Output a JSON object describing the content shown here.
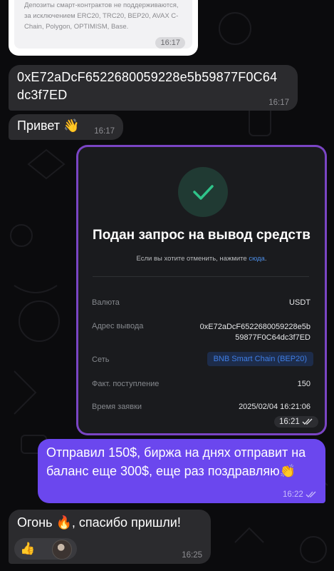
{
  "colors": {
    "chat_bg": "#0b0b0d",
    "incoming_bubble": "#2b2b2e",
    "outgoing_bubble": "#6b47ee",
    "image_border": "#7a45c4",
    "success_green": "#2fc48a",
    "link_blue": "#4c8ee8"
  },
  "messages": {
    "quoted_card": {
      "text": "Депозиты смарт-контрактов не поддерживаются, за исключением ERC20, TRC20, BEP20, AVAX C-Chain, Polygon, OPTIMISM, Base.",
      "time": "16:17"
    },
    "address": {
      "text": "0xE72aDcF6522680059228e5b59877F0C64dc3f7ED",
      "time": "16:17"
    },
    "greeting": {
      "text": "Привет 👋",
      "time": "16:17"
    },
    "withdraw_screenshot": {
      "icon": "check-icon",
      "title": "Подан запрос на вывод средств",
      "subtitle_prefix": "Если вы хотите отменить, нажмите ",
      "subtitle_link": "сюда",
      "subtitle_suffix": ".",
      "rows": [
        {
          "label": "Валюта",
          "value": "USDT"
        },
        {
          "label": "Адрес вывода",
          "value_line1": "0xE72aDcF6522680059228e5b",
          "value_line2": "59877F0C64dc3f7ED"
        },
        {
          "label": "Сеть",
          "value": "BNB Smart Chain (BEP20)"
        },
        {
          "label": "Факт. поступление",
          "value": "150"
        },
        {
          "label": "Время заявки",
          "value": "2025/02/04 16:21:06"
        }
      ],
      "time": "16:21",
      "status_icon": "double-check-icon"
    },
    "outgoing": {
      "text": "Отправил 150$, биржа на днях отправит на баланс еще 300$, еще раз поздравляю👏",
      "time": "16:22",
      "status_icon": "double-check-icon"
    },
    "reply": {
      "text": "Огонь 🔥, спасибо пришли!",
      "reaction_emoji": "👍",
      "reaction_icon": "thumbs-up-icon",
      "time": "16:25"
    }
  }
}
